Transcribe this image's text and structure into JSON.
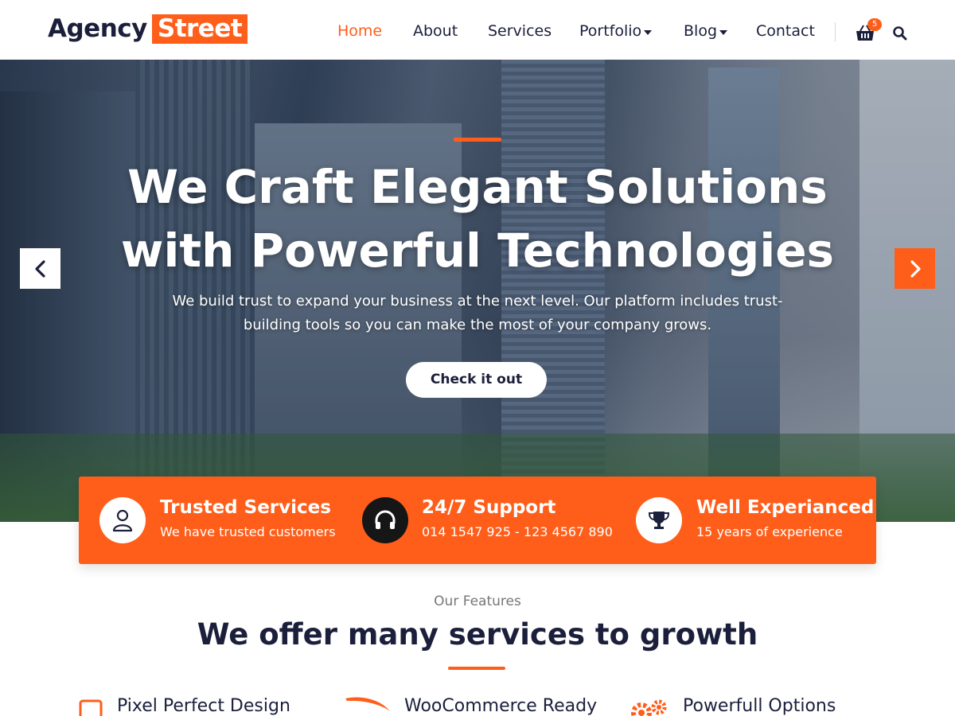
{
  "header": {
    "logo_primary": "Agency",
    "logo_highlight": "Street",
    "nav": [
      {
        "label": "Home",
        "active": true
      },
      {
        "label": "About"
      },
      {
        "label": "Services"
      },
      {
        "label": "Portfolio",
        "dropdown": true
      },
      {
        "label": "Blog",
        "dropdown": true
      },
      {
        "label": "Contact"
      }
    ],
    "cart_count": "5"
  },
  "hero": {
    "title": "We Craft Elegant Solutions with Powerful Technologies",
    "subtitle": "We build trust to expand your business at the next level. Our platform includes trust-building tools so you can make the most of your company grows.",
    "button_label": "Check it out"
  },
  "highlights": [
    {
      "icon": "user-icon",
      "title": "Trusted Services",
      "text": "We have trusted customers"
    },
    {
      "icon": "headphones-icon",
      "title": "24/7 Support",
      "text": "014 1547 925 - 123 4567 890"
    },
    {
      "icon": "trophy-icon",
      "title": "Well Experianced",
      "text": "15 years of experience"
    }
  ],
  "features": {
    "kicker": "Our Features",
    "title_bold": "We offer many",
    "title_rest": "services to growth",
    "items": [
      {
        "icon": "square-icon",
        "title": "Pixel Perfect Design"
      },
      {
        "icon": "swoosh-icon",
        "title": "WooCommerce Ready"
      },
      {
        "icon": "gears-icon",
        "title": "Powerfull Options"
      }
    ]
  },
  "colors": {
    "accent": "#ff5e1a",
    "text_dark": "#1b1f3b"
  }
}
